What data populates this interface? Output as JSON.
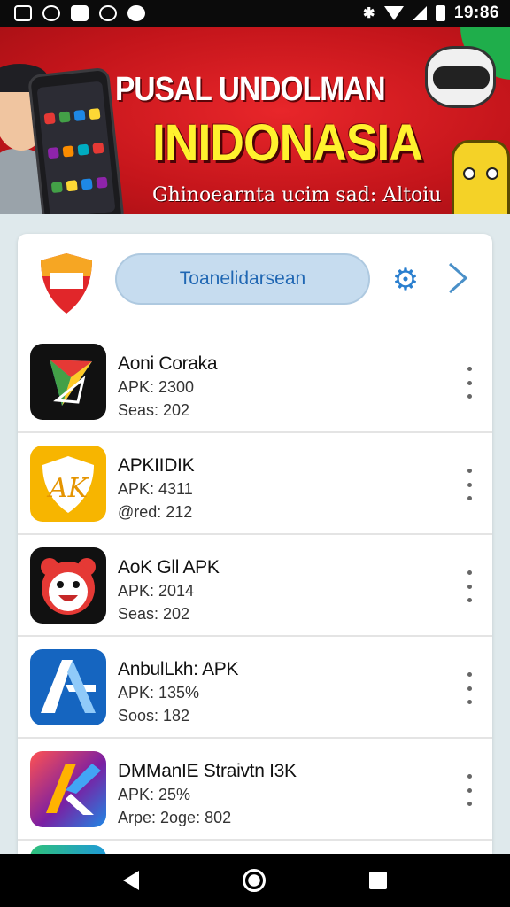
{
  "status_bar": {
    "time": "19:86"
  },
  "banner": {
    "title": "PUSAL UNDOLMAN",
    "headline": "INIDONASIA",
    "subtitle": "Ghinoearnta ucim sad: Altoiu",
    "dots": 4,
    "active_dot": 1
  },
  "header": {
    "search_label": "Toanelidarsean"
  },
  "apps": [
    {
      "title": "Aoni Coraka",
      "line1": "APK: 2300",
      "line2": "Seas: 202"
    },
    {
      "title": "APKIIDIK",
      "line1": "APK: 4311",
      "line2": "@red: 212"
    },
    {
      "title": "AoK Gll APK",
      "line1": "APK: 2014",
      "line2": "Seas: 202"
    },
    {
      "title": "AnbulLkh: APK",
      "line1": "APK: 135%",
      "line2": "Soos: 182"
    },
    {
      "title": "DMManIE Straivtn I3K",
      "line1": "APK: 25%",
      "line2": "Arpe: 2oge: 802"
    }
  ],
  "colors": {
    "banner_red": "#d71f25",
    "headline_yellow": "#fff22e",
    "search_bg": "#c6dcef",
    "accent_blue": "#2a7fcf"
  }
}
